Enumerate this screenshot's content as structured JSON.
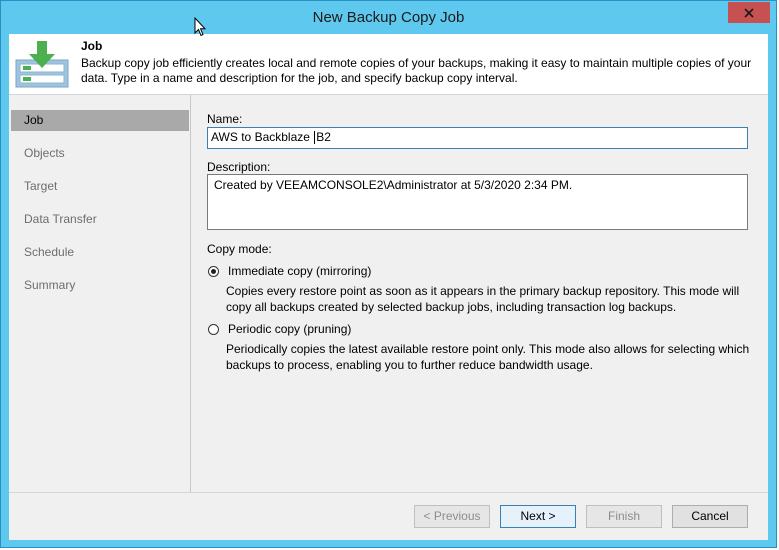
{
  "window": {
    "title": "New Backup Copy Job",
    "close_icon": "close-icon"
  },
  "header": {
    "title": "Job",
    "description": "Backup copy job efficiently creates local and remote copies of your backups, making it easy to maintain multiple copies of your data. Type in a name and description for the job, and specify backup copy interval.",
    "icon": "backup-copy-download-icon"
  },
  "nav": {
    "items": [
      {
        "label": "Job"
      },
      {
        "label": "Objects"
      },
      {
        "label": "Target"
      },
      {
        "label": "Data Transfer"
      },
      {
        "label": "Schedule"
      },
      {
        "label": "Summary"
      }
    ]
  },
  "form": {
    "name_label": "Name:",
    "name_value_before_caret": "AWS to Backblaze ",
    "name_value_after_caret": "B2",
    "description_label": "Description:",
    "description_value": "Created by VEEAMCONSOLE2\\Administrator at 5/3/2020 2:34 PM.",
    "copy_mode_label": "Copy mode:",
    "immediate": {
      "label": "Immediate copy (mirroring)",
      "checked": true,
      "description": "Copies every restore point as soon as it appears in the primary backup repository. This mode will copy all backups created by selected backup jobs, including transaction log backups."
    },
    "periodic": {
      "label": "Periodic copy (pruning)",
      "checked": false,
      "description": "Periodically copies the latest available restore point only. This mode also allows for selecting which backups to process, enabling you to further reduce bandwidth usage."
    }
  },
  "footer": {
    "previous": "< Previous",
    "next": "Next >",
    "finish": "Finish",
    "cancel": "Cancel"
  },
  "colors": {
    "title_bar": "#5ec8ee",
    "close_button": "#c75050",
    "nav_selected": "#a9a9a9",
    "icon_green": "#4caf50"
  }
}
